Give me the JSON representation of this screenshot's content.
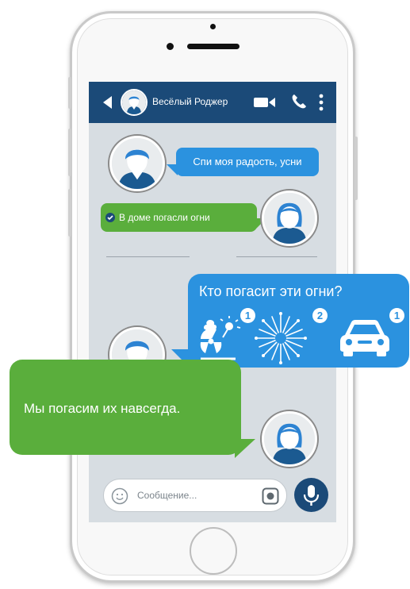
{
  "header": {
    "contact_name": "Весёлый Роджер"
  },
  "messages": [
    {
      "id": "m1",
      "direction": "incoming",
      "text": "Спи моя радость, усни"
    },
    {
      "id": "m2",
      "direction": "outgoing",
      "text": "В доме погасли огни",
      "status": "read"
    }
  ],
  "highlight_messages": {
    "question": "Кто погасит эти огни?",
    "answer": "Мы погасим их навсегда."
  },
  "question_icons": [
    {
      "icon": "nuclear-blast-icon",
      "badge": "1"
    },
    {
      "icon": "fireworks-icon",
      "badge": "2"
    },
    {
      "icon": "car-icon",
      "badge": "1"
    }
  ],
  "composer": {
    "placeholder": "Сообщение..."
  },
  "colors": {
    "header": "#1b4a78",
    "incoming_bubble": "#2b92df",
    "outgoing_bubble": "#5aae3c",
    "chat_bg": "#d7dde2"
  }
}
